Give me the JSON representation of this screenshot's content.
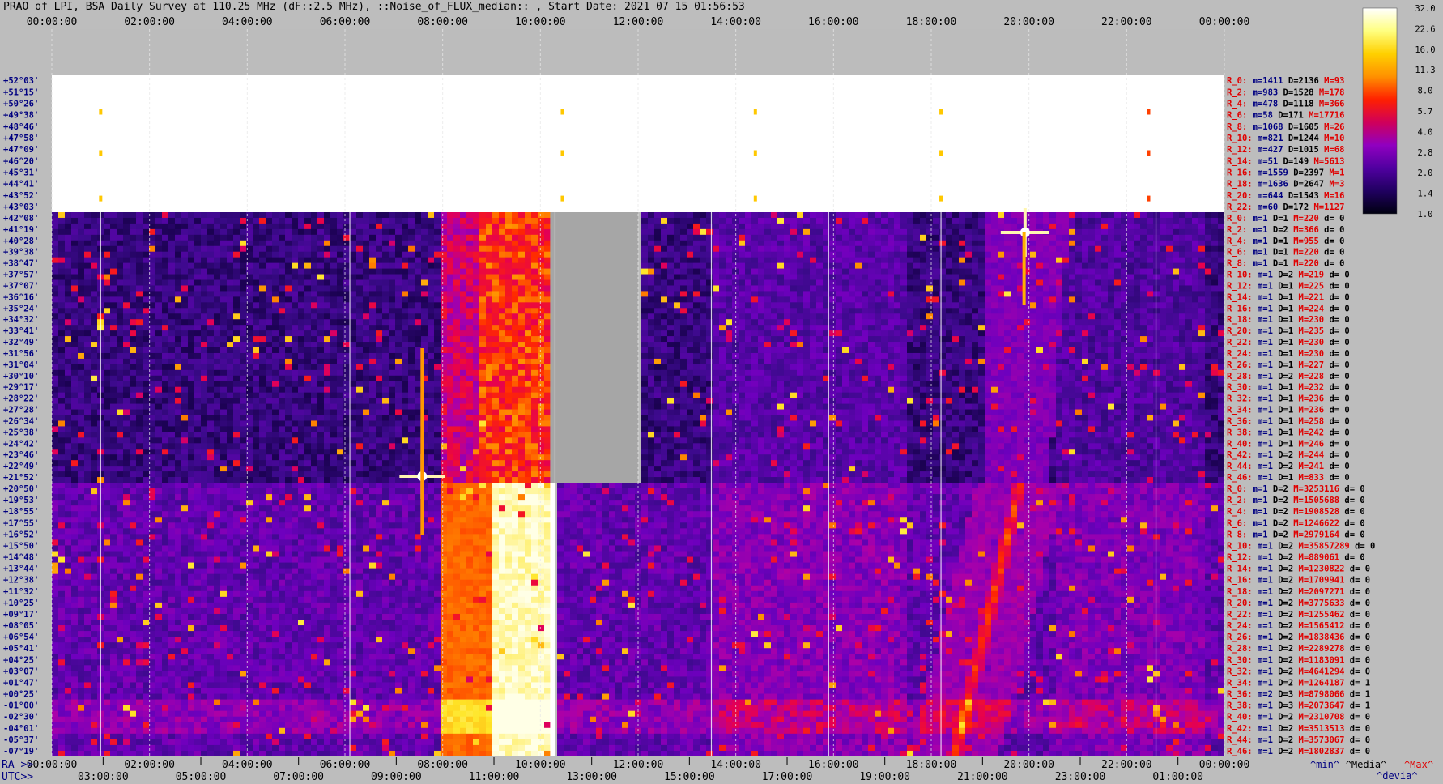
{
  "title": "PRAO of LPI, BSA Daily Survey at 110.25 MHz (dF::2.5 MHz), ::Noise_of_FLUX_median:: , Start Date: 2021 07 15 01:56:53",
  "axis": {
    "ra_prefix": "RA >>",
    "utc_prefix": "UTC>>",
    "ra_ticks": [
      "00:00:00",
      "02:00:00",
      "04:00:00",
      "06:00:00",
      "08:00:00",
      "10:00:00",
      "12:00:00",
      "14:00:00",
      "16:00:00",
      "18:00:00",
      "20:00:00",
      "22:00:00",
      "00:00:00"
    ],
    "utc_ticks": [
      "03:00:00",
      "05:00:00",
      "07:00:00",
      "09:00:00",
      "11:00:00",
      "13:00:00",
      "15:00:00",
      "17:00:00",
      "19:00:00",
      "21:00:00",
      "23:00:00",
      "01:00:00"
    ]
  },
  "colorbar": {
    "labels": [
      "32.0",
      "22.6",
      "16.0",
      "11.3",
      "8.0",
      "5.7",
      "4.0",
      "2.8",
      "2.0",
      "1.4",
      "1.0"
    ],
    "colors": [
      "#ffffff",
      "#ffff80",
      "#ffd000",
      "#ff9000",
      "#ff2000",
      "#d0005a",
      "#9000c0",
      "#5000a0",
      "#200060",
      "#000010"
    ]
  },
  "declinations": {
    "group1": [
      "+52°03'",
      "+51°15'",
      "+50°26'",
      "+49°38'",
      "+48°46'",
      "+47°58'",
      "+47°09'",
      "+46°20'",
      "+45°31'",
      "+44°41'",
      "+43°52'",
      "+43°03'"
    ],
    "group2": [
      "+42°08'",
      "+41°19'",
      "+40°28'",
      "+39°38'",
      "+38°47'",
      "+37°57'",
      "+37°07'",
      "+36°16'",
      "+35°24'",
      "+34°32'",
      "+33°41'",
      "+32°49'",
      "+31°56'",
      "+31°04'",
      "+30°10'",
      "+29°17'",
      "+28°22'",
      "+27°28'",
      "+26°34'",
      "+25°38'",
      "+24°42'",
      "+23°46'",
      "+22°49'",
      "+21°52'"
    ],
    "group3": [
      "+20°50'",
      "+19°53'",
      "+18°55'",
      "+17°55'",
      "+16°52'",
      "+15°50'",
      "+14°48'",
      "+13°44'",
      "+12°38'",
      "+11°32'",
      "+10°25'",
      "+09°17'",
      "+08°05'",
      "+06°54'",
      "+05°41'",
      "+04°25'",
      "+03°07'",
      "+01°47'",
      "+00°25'",
      "-01°00'",
      "-02°30'",
      "-04°01'",
      "-05°37'",
      "-07°19'"
    ]
  },
  "ray_stats": {
    "group1": [
      {
        "r": "R_0:",
        "m": "m=1411",
        "D": "D=2136",
        "M": "M=93"
      },
      {
        "r": "R_2:",
        "m": "m=983",
        "D": "D=1528",
        "M": "M=178"
      },
      {
        "r": "R_4:",
        "m": "m=478",
        "D": "D=1118",
        "M": "M=366"
      },
      {
        "r": "R_6:",
        "m": "m=58",
        "D": "D=171",
        "M": "M=17716"
      },
      {
        "r": "R_8:",
        "m": "m=1068",
        "D": "D=1605",
        "M": "M=26"
      },
      {
        "r": "R_10:",
        "m": "m=821",
        "D": "D=1244",
        "M": "M=10"
      },
      {
        "r": "R_12:",
        "m": "m=427",
        "D": "D=1015",
        "M": "M=68"
      },
      {
        "r": "R_14:",
        "m": "m=51",
        "D": "D=149",
        "M": "M=5613"
      },
      {
        "r": "R_16:",
        "m": "m=1559",
        "D": "D=2397",
        "M": "M=1"
      },
      {
        "r": "R_18:",
        "m": "m=1636",
        "D": "D=2647",
        "M": "M=3"
      },
      {
        "r": "R_20:",
        "m": "m=644",
        "D": "D=1543",
        "M": "M=16"
      },
      {
        "r": "R_22:",
        "m": "m=60",
        "D": "D=172",
        "M": "M=1127"
      }
    ],
    "group2": [
      {
        "r": "R_0:",
        "m": "m=1",
        "D": "D=1",
        "M": "M=220",
        "d": "d= 0"
      },
      {
        "r": "R_2:",
        "m": "m=1",
        "D": "D=2",
        "M": "M=366",
        "d": "d= 0"
      },
      {
        "r": "R_4:",
        "m": "m=1",
        "D": "D=1",
        "M": "M=955",
        "d": "d= 0"
      },
      {
        "r": "R_6:",
        "m": "m=1",
        "D": "D=1",
        "M": "M=220",
        "d": "d= 0"
      },
      {
        "r": "R_8:",
        "m": "m=1",
        "D": "D=1",
        "M": "M=220",
        "d": "d= 0"
      },
      {
        "r": "R_10:",
        "m": "m=1",
        "D": "D=2",
        "M": "M=219",
        "d": "d= 0"
      },
      {
        "r": "R_12:",
        "m": "m=1",
        "D": "D=1",
        "M": "M=225",
        "d": "d= 0"
      },
      {
        "r": "R_14:",
        "m": "m=1",
        "D": "D=1",
        "M": "M=221",
        "d": "d= 0"
      },
      {
        "r": "R_16:",
        "m": "m=1",
        "D": "D=1",
        "M": "M=224",
        "d": "d= 0"
      },
      {
        "r": "R_18:",
        "m": "m=1",
        "D": "D=1",
        "M": "M=230",
        "d": "d= 0"
      },
      {
        "r": "R_20:",
        "m": "m=1",
        "D": "D=1",
        "M": "M=235",
        "d": "d= 0"
      },
      {
        "r": "R_22:",
        "m": "m=1",
        "D": "D=1",
        "M": "M=230",
        "d": "d= 0"
      },
      {
        "r": "R_24:",
        "m": "m=1",
        "D": "D=1",
        "M": "M=230",
        "d": "d= 0"
      },
      {
        "r": "R_26:",
        "m": "m=1",
        "D": "D=1",
        "M": "M=227",
        "d": "d= 0"
      },
      {
        "r": "R_28:",
        "m": "m=1",
        "D": "D=2",
        "M": "M=228",
        "d": "d= 0"
      },
      {
        "r": "R_30:",
        "m": "m=1",
        "D": "D=1",
        "M": "M=232",
        "d": "d= 0"
      },
      {
        "r": "R_32:",
        "m": "m=1",
        "D": "D=1",
        "M": "M=236",
        "d": "d= 0"
      },
      {
        "r": "R_34:",
        "m": "m=1",
        "D": "D=1",
        "M": "M=236",
        "d": "d= 0"
      },
      {
        "r": "R_36:",
        "m": "m=1",
        "D": "D=1",
        "M": "M=258",
        "d": "d= 0"
      },
      {
        "r": "R_38:",
        "m": "m=1",
        "D": "D=1",
        "M": "M=242",
        "d": "d= 0"
      },
      {
        "r": "R_40:",
        "m": "m=1",
        "D": "D=1",
        "M": "M=246",
        "d": "d= 0"
      },
      {
        "r": "R_42:",
        "m": "m=1",
        "D": "D=2",
        "M": "M=244",
        "d": "d= 0"
      },
      {
        "r": "R_44:",
        "m": "m=1",
        "D": "D=2",
        "M": "M=241",
        "d": "d= 0"
      },
      {
        "r": "R_46:",
        "m": "m=1",
        "D": "D=1",
        "M": "M=833",
        "d": "d= 0"
      }
    ],
    "group3": [
      {
        "r": "R_0:",
        "m": "m=1",
        "D": "D=2",
        "M": "M=3253116",
        "d": "d= 0"
      },
      {
        "r": "R_2:",
        "m": "m=1",
        "D": "D=2",
        "M": "M=1505688",
        "d": "d= 0"
      },
      {
        "r": "R_4:",
        "m": "m=1",
        "D": "D=2",
        "M": "M=1908528",
        "d": "d= 0"
      },
      {
        "r": "R_6:",
        "m": "m=1",
        "D": "D=2",
        "M": "M=1246622",
        "d": "d= 0"
      },
      {
        "r": "R_8:",
        "m": "m=1",
        "D": "D=2",
        "M": "M=2979164",
        "d": "d= 0"
      },
      {
        "r": "R_10:",
        "m": "m=1",
        "D": "D=2",
        "M": "M=35857289",
        "d": "d= 0"
      },
      {
        "r": "R_12:",
        "m": "m=1",
        "D": "D=2",
        "M": "M=889061",
        "d": "d= 0"
      },
      {
        "r": "R_14:",
        "m": "m=1",
        "D": "D=2",
        "M": "M=1230822",
        "d": "d= 0"
      },
      {
        "r": "R_16:",
        "m": "m=1",
        "D": "D=2",
        "M": "M=1709941",
        "d": "d= 0"
      },
      {
        "r": "R_18:",
        "m": "m=1",
        "D": "D=2",
        "M": "M=2097271",
        "d": "d= 0"
      },
      {
        "r": "R_20:",
        "m": "m=1",
        "D": "D=2",
        "M": "M=3775633",
        "d": "d= 0"
      },
      {
        "r": "R_22:",
        "m": "m=1",
        "D": "D=2",
        "M": "M=1255462",
        "d": "d= 0"
      },
      {
        "r": "R_24:",
        "m": "m=1",
        "D": "D=2",
        "M": "M=1565412",
        "d": "d= 0"
      },
      {
        "r": "R_26:",
        "m": "m=1",
        "D": "D=2",
        "M": "M=1838436",
        "d": "d= 0"
      },
      {
        "r": "R_28:",
        "m": "m=1",
        "D": "D=2",
        "M": "M=2289278",
        "d": "d= 0"
      },
      {
        "r": "R_30:",
        "m": "m=1",
        "D": "D=2",
        "M": "M=1183091",
        "d": "d= 0"
      },
      {
        "r": "R_32:",
        "m": "m=1",
        "D": "D=2",
        "M": "M=4641294",
        "d": "d= 0"
      },
      {
        "r": "R_34:",
        "m": "m=1",
        "D": "D=2",
        "M": "M=1264187",
        "d": "d= 1"
      },
      {
        "r": "R_36:",
        "m": "m=2",
        "D": "D=3",
        "M": "M=8798066",
        "d": "d= 1"
      },
      {
        "r": "R_38:",
        "m": "m=1",
        "D": "D=3",
        "M": "M=2073647",
        "d": "d= 1"
      },
      {
        "r": "R_40:",
        "m": "m=1",
        "D": "D=2",
        "M": "M=2310708",
        "d": "d= 0"
      },
      {
        "r": "R_42:",
        "m": "m=1",
        "D": "D=2",
        "M": "M=3513513",
        "d": "d= 0"
      },
      {
        "r": "R_44:",
        "m": "m=1",
        "D": "D=2",
        "M": "M=3573067",
        "d": "d= 0"
      },
      {
        "r": "R_46:",
        "m": "m=1",
        "D": "D=2",
        "M": "M=1802837",
        "d": "d= 0"
      }
    ]
  },
  "legend_keys": {
    "min": "^min^",
    "median": "^Media^",
    "max": "^Max^",
    "devia": "^devia^"
  },
  "chart_data": {
    "type": "heatmap",
    "title": "PRAO of LPI, BSA Daily Survey at 110.25 MHz (dF::2.5 MHz), ::Noise_of_FLUX_median:: , Start Date: 2021 07 15 01:56:53",
    "x_axis_top": "RA",
    "x_axis_bottom": "UTC",
    "xlim_ra_hours": [
      0,
      24
    ],
    "color_scale": "log",
    "zlim": [
      1.0,
      32.0
    ],
    "bands": [
      {
        "name": "group1",
        "rays": 12,
        "dec_range": [
          "+52°03'",
          "+43°03'"
        ],
        "saturated": true
      },
      {
        "name": "group2",
        "rays": 24,
        "dec_range": [
          "+42°08'",
          "+21°52'"
        ],
        "gap_ra_hours": [
          10.2,
          12.0
        ]
      },
      {
        "name": "group3",
        "rays": 24,
        "dec_range": [
          "+20°50'",
          "-07°19'"
        ],
        "gap_ra_hours": [
          10.2,
          12.0
        ]
      }
    ],
    "features": [
      {
        "label": "bright source",
        "ra": "19:55",
        "dec": "+41°19'",
        "level": "32.0"
      },
      {
        "label": "bright source",
        "ra": "07:35",
        "dec": "+21°52'",
        "level": "32.0"
      },
      {
        "label": "bright strip",
        "ra_range": [
          "07:50",
          "10:15"
        ],
        "level": "32.0"
      },
      {
        "label": "galactic plane",
        "ra_range": [
          "18:30",
          "19:50"
        ],
        "level": "11.3"
      }
    ]
  }
}
